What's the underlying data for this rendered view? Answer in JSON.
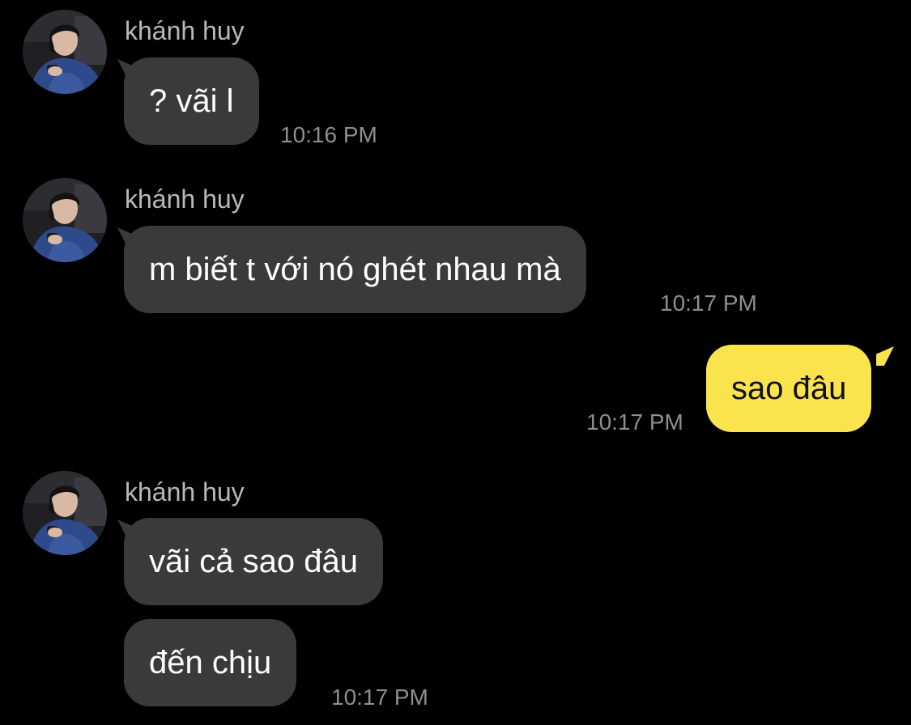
{
  "contact": {
    "name": "khánh huy",
    "avatar_icon": "profile-photo"
  },
  "colors": {
    "background": "#000000",
    "incoming_bubble": "#3a3a3c",
    "outgoing_bubble": "#fae34c",
    "timestamp": "#8e8e93"
  },
  "messages": [
    {
      "sender": "khánh huy",
      "text": "? vãi l",
      "time": "10:16 PM",
      "direction": "incoming"
    },
    {
      "sender": "khánh huy",
      "text": "m biết t với nó ghét nhau mà",
      "time": "10:17 PM",
      "direction": "incoming"
    },
    {
      "text": "sao đâu",
      "time": "10:17 PM",
      "direction": "outgoing"
    },
    {
      "sender": "khánh huy",
      "text": "vãi cả sao đâu",
      "direction": "incoming"
    },
    {
      "text": "đến chịu",
      "time": "10:17 PM",
      "direction": "incoming"
    }
  ]
}
